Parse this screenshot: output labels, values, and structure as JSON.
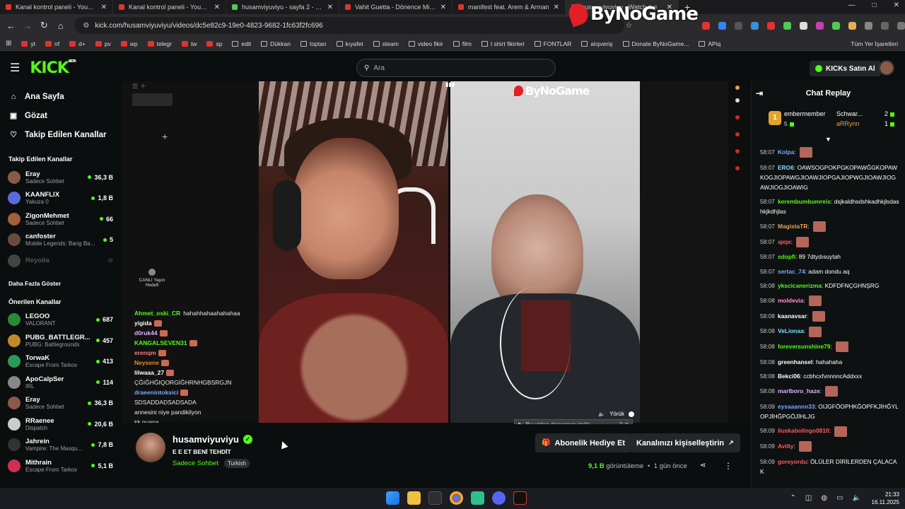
{
  "browser": {
    "tabs": [
      {
        "title": "Kanal kontrol paneli - YouTube",
        "icon": "youtube-icon",
        "active": false
      },
      {
        "title": "Kanal kontrol paneli - YouTube",
        "icon": "youtube-icon",
        "active": false
      },
      {
        "title": "husamviyuviyu - sayfa 2 - ekşi s",
        "icon": "eksi-icon",
        "active": false
      },
      {
        "title": "Vahit Guetta - Dönence Mix KO",
        "icon": "youtube-icon",
        "active": false
      },
      {
        "title": "manifest feat. Arem & Arman",
        "icon": "youtube-icon",
        "active": false
      },
      {
        "title": "husamviyuviyu - Watch the",
        "icon": "kick-icon",
        "active": true
      }
    ],
    "url": "kick.com/husamviyuviyu/videos/dc5e82c9-19e0-4823-9682-1fc63f2fc696",
    "bookmarks": [
      "yt",
      "nf",
      "d+",
      "pv",
      "wp",
      "telegr",
      "tw",
      "sp",
      "edit",
      "Dükkan",
      "toptan",
      "kıyafet",
      "steam",
      "video fikir",
      "film",
      "t shirt fikirleri",
      "FONTLAR",
      "alışveriş",
      "Donate ByNoGame...",
      "APiq"
    ],
    "bookmarks_right": "Tüm Yer İşaretleri"
  },
  "watermark": "ByNoGame",
  "header": {
    "logo": "KICK",
    "logo_sup": "BETA",
    "search_placeholder": "Ara",
    "kicks_button": "KICKs Satın Al"
  },
  "sidebar": {
    "nav": [
      {
        "label": "Ana Sayfa",
        "icon": "home-icon"
      },
      {
        "label": "Gözat",
        "icon": "browse-icon"
      },
      {
        "label": "Takip Edilen Kanallar",
        "icon": "heart-icon"
      }
    ],
    "followed_title": "Takip Edilen Kanallar",
    "followed": [
      {
        "name": "Eray",
        "category": "Sadece Sohbet",
        "viewers": "36,3 B"
      },
      {
        "name": "KAANFLIX",
        "category": "Yakuza 0",
        "viewers": "1,8 B"
      },
      {
        "name": "ZigonMehmet",
        "category": "Sadece Sohbet",
        "viewers": "66"
      },
      {
        "name": "canfoster",
        "category": "Mobile Legends: Bang Ba...",
        "viewers": "5"
      },
      {
        "name": "Reyolia",
        "category": "",
        "viewers": ""
      }
    ],
    "show_more": "Daha Fazla Göster",
    "recommended_title": "Önerilen Kanallar",
    "recommended": [
      {
        "name": "LEGOO",
        "category": "VALORANT",
        "viewers": "687"
      },
      {
        "name": "PUBG_BATTLEGR...",
        "category": "PUBG: Battlegrounds",
        "viewers": "457"
      },
      {
        "name": "TorwaK",
        "category": "Escape From Tarkov",
        "viewers": "413"
      },
      {
        "name": "ApoCalpSer",
        "category": "IRL",
        "viewers": "114"
      },
      {
        "name": "Eray",
        "category": "Sadece Sohbet",
        "viewers": "36,3 B"
      },
      {
        "name": "RRaenee",
        "category": "Dispatch",
        "viewers": "20,6 B"
      },
      {
        "name": "Jahrein",
        "category": "Vampire: The Masqu...",
        "viewers": "7,8 B"
      },
      {
        "name": "Mithrain",
        "category": "Escape From Tarkov",
        "viewers": "5,1 B"
      }
    ]
  },
  "player": {
    "live_goal": "CANLI Yayın Hedefi",
    "overlay_chat": [
      {
        "user": "Ahmet_oski_CR",
        "color": "#53fc18",
        "text": "hahahhahaahahahaa"
      },
      {
        "user": "yigida",
        "color": "#ffffff",
        "text": ""
      },
      {
        "user": "d0ruk44",
        "color": "#e0b3ff",
        "text": ""
      },
      {
        "user": "KANGALSEVEN31",
        "color": "#53fc18",
        "text": ""
      },
      {
        "user": "erenqm",
        "color": "#ff7a7a",
        "text": ""
      },
      {
        "user": "Neysene",
        "color": "#e88a2a",
        "text": ""
      },
      {
        "user": "lilwaaa_27",
        "color": "#ffffff",
        "text": ""
      },
      {
        "user": "",
        "color": "#ffffff",
        "text": "ÇĞIĞHĞIQORGİĞHRNHGBSRGJN"
      },
      {
        "user": "draeenintoksici",
        "color": "#7aa8ff",
        "text": ""
      },
      {
        "user": "",
        "color": "#ffffff",
        "text": "SDSADDADSADSADA"
      },
      {
        "user": "",
        "color": "#ffffff",
        "text": "annesini niye pandikliyon"
      },
      {
        "user": "",
        "color": "#ffffff",
        "text": "kk puana"
      }
    ],
    "cam_logo": "ByNoGame",
    "mute_label": "Yörük",
    "download_bar": "Bu video dosyasını indir"
  },
  "stream_info": {
    "channel": "husamviyuviyu",
    "title": "E E ET BENİ TEHDİT",
    "category": "Sadece Sohbet",
    "tag": "Turkish",
    "gift_button": "Abonelik Hediye Et",
    "customize_button": "Kanalınızı kişiselleştirin",
    "views": "9,1 B",
    "views_label": "görüntüleme",
    "ago": "1 gün önce"
  },
  "chat": {
    "title": "Chat Replay",
    "leaders": [
      {
        "name": "embermember",
        "count": "5"
      },
      {
        "name": "Schwar...",
        "count": "2"
      },
      {
        "name": "aRRynn",
        "count": "1"
      }
    ],
    "messages": [
      {
        "time": "58:07",
        "user": "Kolpa",
        "color": "#7aa8ff",
        "text": "",
        "emote": true
      },
      {
        "time": "58:07",
        "user": "ERO6",
        "color": "#7ae0ff",
        "text": "OAWSOGPOKPGKOPAWĞGKOPAWKOGJIOPAWGJIOAWJIOPGAJIOPWGJIOAWJIOGAWJIOGJIOAWIG",
        "emote": false
      },
      {
        "time": "58:07",
        "user": "kerembumbumreis",
        "color": "#53fc18",
        "text": "dsjkaldhsdshkadhkjlsdashkjkdhjlas",
        "emote": false
      },
      {
        "time": "58:07",
        "user": "MagistaTR",
        "color": "#e8a24a",
        "text": "",
        "emote": true
      },
      {
        "time": "58:07",
        "user": "ajeje",
        "color": "#ff5a5a",
        "text": "",
        "emote": true
      },
      {
        "time": "58:07",
        "user": "sdopfi",
        "color": "#53fc18",
        "text": "89 7dtydısuytah",
        "emote": false
      },
      {
        "time": "58:07",
        "user": "sertac_74",
        "color": "#7aa8ff",
        "text": "adam dondu aq",
        "emote": false
      },
      {
        "time": "58:08",
        "user": "ykscicanerizma",
        "color": "#53fc18",
        "text": "KDFDFNÇGHNŞRG",
        "emote": false
      },
      {
        "time": "58:08",
        "user": "moldevia",
        "color": "#ff8fd0",
        "text": "",
        "emote": true
      },
      {
        "time": "58:08",
        "user": "kaanavsar",
        "color": "#ffffff",
        "text": "",
        "emote": true
      },
      {
        "time": "58:08",
        "user": "VeLionaa",
        "color": "#7ae0ff",
        "text": "",
        "emote": true
      },
      {
        "time": "58:08",
        "user": "foreversunshine79",
        "color": "#53fc18",
        "text": "",
        "emote": true
      },
      {
        "time": "58:08",
        "user": "greenhansel",
        "color": "#ffffff",
        "text": "hahahaha",
        "emote": false
      },
      {
        "time": "58:08",
        "user": "Bekci06",
        "color": "#ffffff",
        "text": "ccbhcxfvnnnncAddxxx",
        "emote": false
      },
      {
        "time": "58:08",
        "user": "marlboro_haze",
        "color": "#e0b3ff",
        "text": "",
        "emote": true
      },
      {
        "time": "58:09",
        "user": "eysaaannn33",
        "color": "#7aa8ff",
        "text": "OIJGFÖOPHKĞOPFKJİHĞYLOPJİHĞPGÖJİHLJG",
        "emote": false
      },
      {
        "time": "58:09",
        "user": "iluskabolingo0810",
        "color": "#ff5a5a",
        "text": "",
        "emote": true
      },
      {
        "time": "58:09",
        "user": "Avilty",
        "color": "#ff5a5a",
        "text": "",
        "emote": true
      },
      {
        "time": "58:09",
        "user": "goreyordu",
        "color": "#ff5a5a",
        "text": "ÖLÜLER DİRİLERDEN ÇALACAK",
        "emote": false
      }
    ]
  },
  "taskbar": {
    "time": "21:33",
    "date": "16.11.2025"
  }
}
